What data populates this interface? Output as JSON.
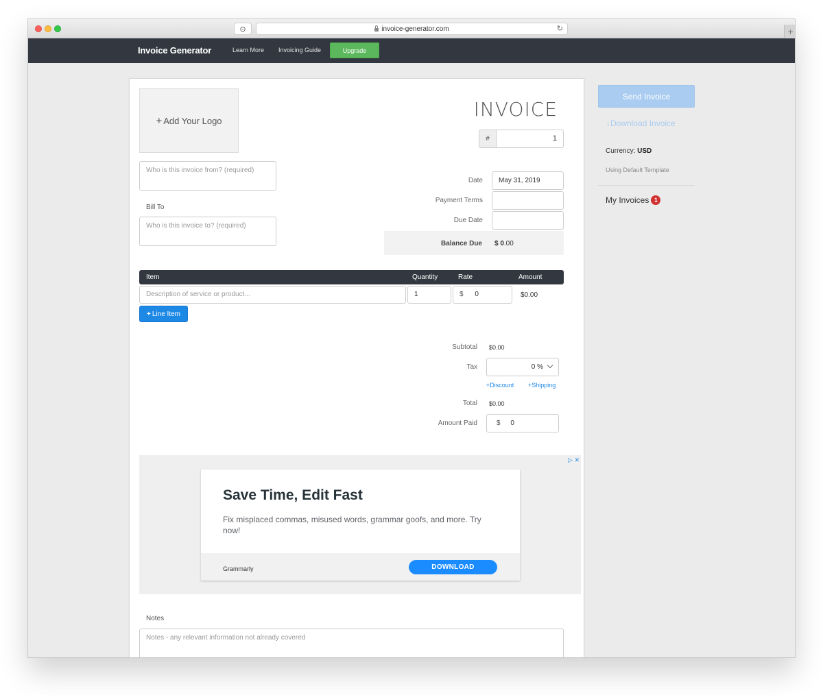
{
  "browser": {
    "url": "invoice-generator.com",
    "reader_icon": "reader-icon",
    "reload_icon": "↻",
    "newtab": "+"
  },
  "nav": {
    "brand": "Invoice Generator",
    "learn_more": "Learn More",
    "invoicing_guide": "Invoicing Guide",
    "upgrade": "Upgrade"
  },
  "invoice": {
    "logo_label": "Add Your Logo",
    "title": "INVOICE",
    "number_prefix": "#",
    "number": "1",
    "from_placeholder": "Who is this invoice from? (required)",
    "bill_to_label": "Bill To",
    "to_placeholder": "Who is this invoice to? (required)",
    "date_label": "Date",
    "date_value": "May 31, 2019",
    "payment_terms_label": "Payment Terms",
    "payment_terms_value": "",
    "due_date_label": "Due Date",
    "due_date_value": "",
    "balance_due_label": "Balance Due",
    "balance_due_symbol": "$",
    "balance_due_whole": "0",
    "balance_due_cents": ".00"
  },
  "items": {
    "headers": {
      "item": "Item",
      "quantity": "Quantity",
      "rate": "Rate",
      "amount": "Amount"
    },
    "row": {
      "description_placeholder": "Description of service or product...",
      "quantity": "1",
      "rate_currency": "$",
      "rate": "0",
      "amount": "$0.00"
    },
    "add_line_label": "Line Item"
  },
  "totals": {
    "subtotal_label": "Subtotal",
    "subtotal_value": "$0.00",
    "tax_label": "Tax",
    "tax_value": "0 %",
    "discount_link": "Discount",
    "shipping_link": "Shipping",
    "total_label": "Total",
    "total_value": "$0.00",
    "amount_paid_label": "Amount Paid",
    "amount_paid_currency": "$",
    "amount_paid_value": "0"
  },
  "ad": {
    "title": "Save Time, Edit Fast",
    "text": "Fix misplaced commas, misused words, grammar goofs, and more. Try now!",
    "sponsor": "Grammarly",
    "cta": "DOWNLOAD"
  },
  "notes": {
    "label": "Notes",
    "placeholder": "Notes - any relevant information not already covered"
  },
  "sidebar": {
    "send_invoice": "Send Invoice",
    "download_invoice": "Download Invoice",
    "currency_label": "Currency:",
    "currency_value": "USD",
    "template_text": "Using Default Template",
    "my_invoices": "My Invoices",
    "my_invoices_count": "1"
  },
  "colors": {
    "nav_bg": "#333840",
    "upgrade_green": "#5cb85c",
    "primary_blue": "#1e88e5",
    "disabled_blue": "#a9ccf0",
    "badge_red": "#d0302f"
  }
}
